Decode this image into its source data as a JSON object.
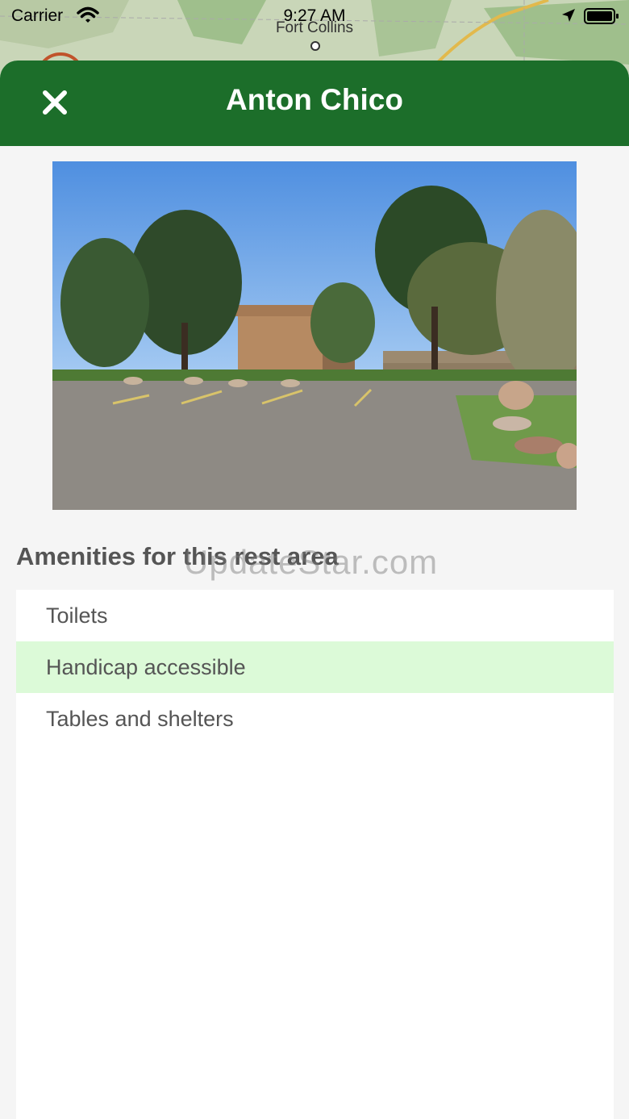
{
  "status_bar": {
    "carrier": "Carrier",
    "time": "9:27 AM"
  },
  "map": {
    "city_label": "Fort Collins"
  },
  "header": {
    "title": "Anton Chico",
    "close_icon": "close-icon",
    "background_color": "#1c6e2a"
  },
  "photo": {
    "subject": "rest-area-photo"
  },
  "amenities": {
    "heading": "Amenities for this rest area",
    "items": [
      {
        "label": "Toilets",
        "highlighted": false
      },
      {
        "label": "Handicap accessible",
        "highlighted": true
      },
      {
        "label": "Tables and shelters",
        "highlighted": false
      }
    ],
    "highlight_color": "#dcfad8"
  },
  "watermark": "UpdateStar.com"
}
